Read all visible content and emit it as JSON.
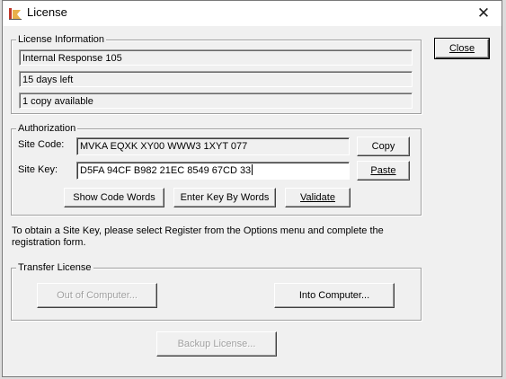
{
  "window": {
    "title": "License",
    "close_glyph": "✕"
  },
  "buttons": {
    "close": "Close",
    "copy": "Copy",
    "paste": "Paste",
    "show_code_words": "Show Code Words",
    "enter_key_by_words": "Enter Key By Words",
    "validate": "Validate",
    "out_of_computer": "Out of Computer...",
    "into_computer": "Into Computer...",
    "backup_license": "Backup License..."
  },
  "license_info": {
    "legend": "License Information",
    "license_type": "Internal Response 105",
    "days_left": "15 days left",
    "copies": "1 copy available"
  },
  "authorization": {
    "legend": "Authorization",
    "site_code_label": "Site Code:",
    "site_code": "MVKA EQXK XY00 WWW3 1XYT 077",
    "site_key_label": "Site Key:",
    "site_key": "D5FA 94CF B982 21EC 8549 67CD 33"
  },
  "note": "To obtain a Site Key, please select Register from the Options menu and complete the registration form.",
  "transfer": {
    "legend": "Transfer License"
  },
  "icons": {
    "app": "app-icon",
    "close": "close-icon"
  }
}
